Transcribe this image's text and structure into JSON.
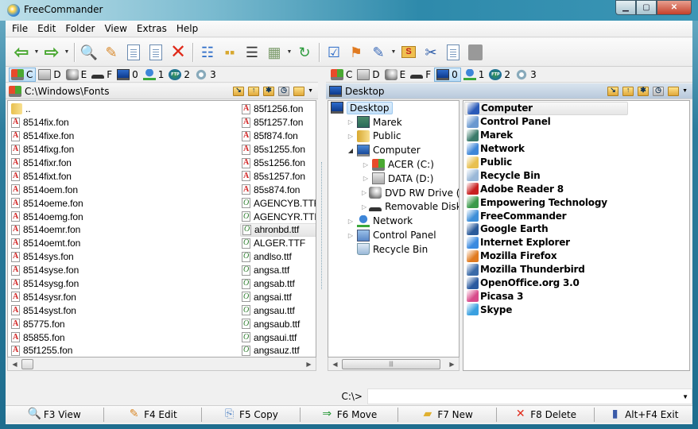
{
  "window": {
    "title": "FreeCommander",
    "minimize_icon": "minimize-icon",
    "maximize_icon": "maximize-icon",
    "close_icon": "close-icon"
  },
  "menu": [
    "File",
    "Edit",
    "Folder",
    "View",
    "Extras",
    "Help"
  ],
  "toolbar": [
    {
      "name": "back-button",
      "icon": "arrow-left-icon"
    },
    {
      "name": "forward-button",
      "icon": "arrow-right-icon"
    },
    {
      "name": "view-button",
      "icon": "magnifier-document-icon"
    },
    {
      "name": "edit-button",
      "icon": "pencil-document-icon"
    },
    {
      "name": "copy-button",
      "icon": "copy-plus-icon"
    },
    {
      "name": "move-button",
      "icon": "move-arrow-icon"
    },
    {
      "name": "delete-button",
      "icon": "red-x-icon"
    },
    {
      "name": "tree-view-button",
      "icon": "tree-icon"
    },
    {
      "name": "list-view-button",
      "icon": "small-icons-icon"
    },
    {
      "name": "details-view-button",
      "icon": "details-icon"
    },
    {
      "name": "thumbnails-view-button",
      "icon": "thumbnails-icon"
    },
    {
      "name": "refresh-button",
      "icon": "refresh-icon"
    },
    {
      "name": "settings-button",
      "icon": "checklist-icon"
    },
    {
      "name": "windows-button",
      "icon": "windows-flag-icon"
    },
    {
      "name": "notepad-button",
      "icon": "notepad-icon"
    },
    {
      "name": "folder-size-button",
      "icon": "folder-s-icon"
    },
    {
      "name": "cut-button",
      "icon": "scissors-icon"
    },
    {
      "name": "copy-clipboard-button",
      "icon": "copy-icon"
    },
    {
      "name": "paste-button",
      "icon": "paste-icon"
    }
  ],
  "drives": [
    {
      "letter": "C",
      "icon": "windows-drive-icon"
    },
    {
      "letter": "D",
      "icon": "hard-drive-icon"
    },
    {
      "letter": "E",
      "icon": "dvd-drive-icon"
    },
    {
      "letter": "F",
      "icon": "removable-drive-icon"
    },
    {
      "letter": "0",
      "icon": "desktop-icon"
    },
    {
      "letter": "1",
      "icon": "network-icon"
    },
    {
      "letter": "2",
      "icon": "ftp-icon"
    },
    {
      "letter": "3",
      "icon": "gear-icon"
    }
  ],
  "left_panel": {
    "active_drive": "C",
    "path": "C:\\Windows\\Fonts",
    "columns": [
      [
        {
          "name": "..",
          "type": "folder"
        },
        {
          "name": "8514fix.fon",
          "type": "fon"
        },
        {
          "name": "8514fixe.fon",
          "type": "fon"
        },
        {
          "name": "8514fixg.fon",
          "type": "fon"
        },
        {
          "name": "8514fixr.fon",
          "type": "fon"
        },
        {
          "name": "8514fixt.fon",
          "type": "fon"
        },
        {
          "name": "8514oem.fon",
          "type": "fon"
        },
        {
          "name": "8514oeme.fon",
          "type": "fon"
        },
        {
          "name": "8514oemg.fon",
          "type": "fon"
        },
        {
          "name": "8514oemr.fon",
          "type": "fon"
        },
        {
          "name": "8514oemt.fon",
          "type": "fon"
        },
        {
          "name": "8514sys.fon",
          "type": "fon"
        },
        {
          "name": "8514syse.fon",
          "type": "fon"
        },
        {
          "name": "8514sysg.fon",
          "type": "fon"
        },
        {
          "name": "8514sysr.fon",
          "type": "fon"
        },
        {
          "name": "8514syst.fon",
          "type": "fon"
        },
        {
          "name": "85775.fon",
          "type": "fon"
        },
        {
          "name": "85855.fon",
          "type": "fon"
        },
        {
          "name": "85f1255.fon",
          "type": "fon"
        }
      ],
      [
        {
          "name": "85f1256.fon",
          "type": "fon"
        },
        {
          "name": "85f1257.fon",
          "type": "fon"
        },
        {
          "name": "85f874.fon",
          "type": "fon"
        },
        {
          "name": "85s1255.fon",
          "type": "fon"
        },
        {
          "name": "85s1256.fon",
          "type": "fon"
        },
        {
          "name": "85s1257.fon",
          "type": "fon"
        },
        {
          "name": "85s874.fon",
          "type": "fon"
        },
        {
          "name": "AGENCYB.TTF",
          "type": "ttf"
        },
        {
          "name": "AGENCYR.TTF",
          "type": "ttf"
        },
        {
          "name": "ahronbd.ttf",
          "type": "ttf",
          "selected": true
        },
        {
          "name": "ALGER.TTF",
          "type": "ttf"
        },
        {
          "name": "andlso.ttf",
          "type": "ttf"
        },
        {
          "name": "angsa.ttf",
          "type": "ttf"
        },
        {
          "name": "angsab.ttf",
          "type": "ttf"
        },
        {
          "name": "angsai.ttf",
          "type": "ttf"
        },
        {
          "name": "angsau.ttf",
          "type": "ttf"
        },
        {
          "name": "angsaub.ttf",
          "type": "ttf"
        },
        {
          "name": "angsaui.ttf",
          "type": "ttf"
        },
        {
          "name": "angsauz.ttf",
          "type": "ttf"
        }
      ]
    ]
  },
  "right_panel": {
    "active_drive": "0",
    "path": "Desktop",
    "tree": [
      {
        "label": "Desktop",
        "level": 0,
        "expander": "",
        "icon": "desk",
        "selected": true
      },
      {
        "label": "Marek",
        "level": 1,
        "expander": "collapsed",
        "icon": "user"
      },
      {
        "label": "Public",
        "level": 1,
        "expander": "collapsed",
        "icon": "fold"
      },
      {
        "label": "Computer",
        "level": 1,
        "expander": "expanded",
        "icon": "comp"
      },
      {
        "label": "ACER (C:)",
        "level": 2,
        "expander": "collapsed",
        "icon": "win"
      },
      {
        "label": "DATA (D:)",
        "level": 2,
        "expander": "collapsed",
        "icon": "hdd"
      },
      {
        "label": "DVD RW Drive (E:)",
        "level": 2,
        "expander": "collapsed",
        "icon": "dvd"
      },
      {
        "label": "Removable Disk (F:)",
        "level": 2,
        "expander": "collapsed",
        "icon": "usb"
      },
      {
        "label": "Network",
        "level": 1,
        "expander": "collapsed",
        "icon": "net"
      },
      {
        "label": "Control Panel",
        "level": 1,
        "expander": "collapsed",
        "icon": "cp"
      },
      {
        "label": "Recycle Bin",
        "level": 1,
        "expander": "",
        "icon": "bin"
      }
    ],
    "items": [
      {
        "name": "Computer",
        "color": "#2a5ab8",
        "selected": true
      },
      {
        "name": "Control Panel",
        "color": "#6a98d0"
      },
      {
        "name": "Marek",
        "color": "#3a7a6a"
      },
      {
        "name": "Network",
        "color": "#3e86d8"
      },
      {
        "name": "Public",
        "color": "#e8c050"
      },
      {
        "name": "Recycle Bin",
        "color": "#9ab8d8"
      },
      {
        "name": "Adobe Reader 8",
        "color": "#c82020"
      },
      {
        "name": "Empowering Technology",
        "color": "#3a9a4a"
      },
      {
        "name": "FreeCommander",
        "color": "#3d8ed8"
      },
      {
        "name": "Google Earth",
        "color": "#2a5a9a"
      },
      {
        "name": "Internet Explorer",
        "color": "#3a8ae0"
      },
      {
        "name": "Mozilla Firefox",
        "color": "#e07a20"
      },
      {
        "name": "Mozilla Thunderbird",
        "color": "#3a6aa8"
      },
      {
        "name": "OpenOffice.org 3.0",
        "color": "#2a5aa0"
      },
      {
        "name": "Picasa 3",
        "color": "#d84a8a"
      },
      {
        "name": "Skype",
        "color": "#3aa0e0"
      }
    ]
  },
  "command_line": {
    "prompt": "C:\\>",
    "value": ""
  },
  "function_keys": [
    {
      "label": "F3 View",
      "icon": "view-icon",
      "glyph": "🔍"
    },
    {
      "label": "F4 Edit",
      "icon": "edit-icon",
      "glyph": "✎"
    },
    {
      "label": "F5 Copy",
      "icon": "copy-icon",
      "glyph": "⎘"
    },
    {
      "label": "F6 Move",
      "icon": "move-icon",
      "glyph": "⇒"
    },
    {
      "label": "F7 New",
      "icon": "new-folder-icon",
      "glyph": "▰"
    },
    {
      "label": "F8 Delete",
      "icon": "delete-icon",
      "glyph": "✕"
    },
    {
      "label": "Alt+F4 Exit",
      "icon": "exit-icon",
      "glyph": "▮"
    }
  ]
}
